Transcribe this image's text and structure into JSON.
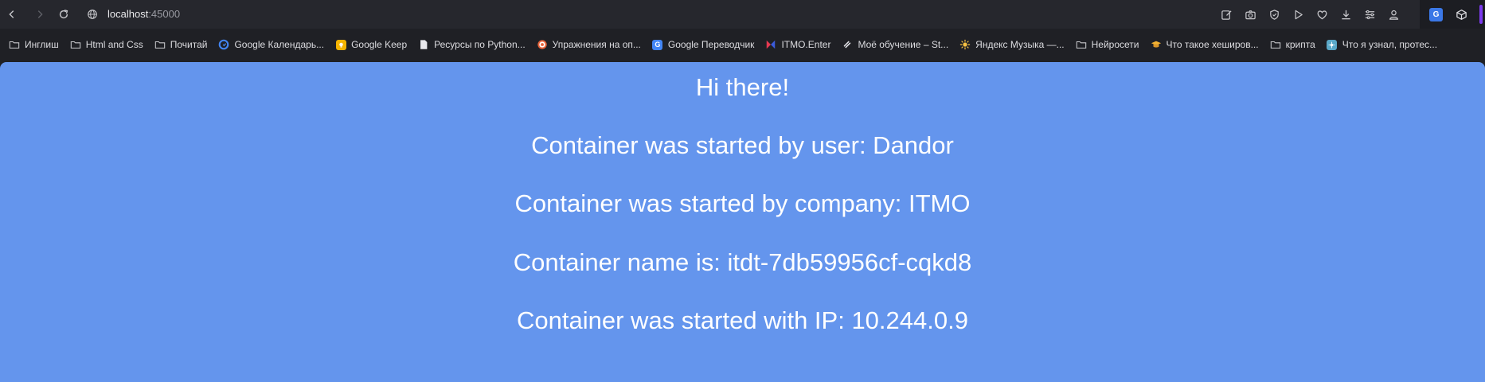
{
  "address_bar": {
    "host": "localhost",
    "port": ":45000"
  },
  "bookmarks": [
    {
      "label": "Инглиш",
      "icon": "folder-icon"
    },
    {
      "label": "Html and Css",
      "icon": "folder-icon"
    },
    {
      "label": "Почитай",
      "icon": "folder-icon"
    },
    {
      "label": "Google Календарь...",
      "icon": "google-calendar-icon"
    },
    {
      "label": "Google Keep",
      "icon": "google-keep-icon"
    },
    {
      "label": "Ресурсы по Python...",
      "icon": "document-icon"
    },
    {
      "label": "Упражнения на оп...",
      "icon": "target-icon"
    },
    {
      "label": "Google Переводчик",
      "icon": "google-translate-icon"
    },
    {
      "label": "ITMO.Enter",
      "icon": "itmo-icon"
    },
    {
      "label": "Моё обучение – St...",
      "icon": "stepik-icon"
    },
    {
      "label": "Яндекс Музыка —...",
      "icon": "yandex-music-icon"
    },
    {
      "label": "Нейросети",
      "icon": "folder-icon"
    },
    {
      "label": "Что такое хеширов...",
      "icon": "graduation-cap-icon"
    },
    {
      "label": "крипта",
      "icon": "folder-icon"
    },
    {
      "label": "Что я узнал, протес...",
      "icon": "article-icon"
    }
  ],
  "page": {
    "background": "#6495ed",
    "lines": [
      "Hi there!",
      "Container was started by user: Dandor",
      "Container was started by company: ITMO",
      "Container name is: itdt-7db59956cf-cqkd8",
      "Container was started with IP: 10.244.0.9"
    ]
  }
}
